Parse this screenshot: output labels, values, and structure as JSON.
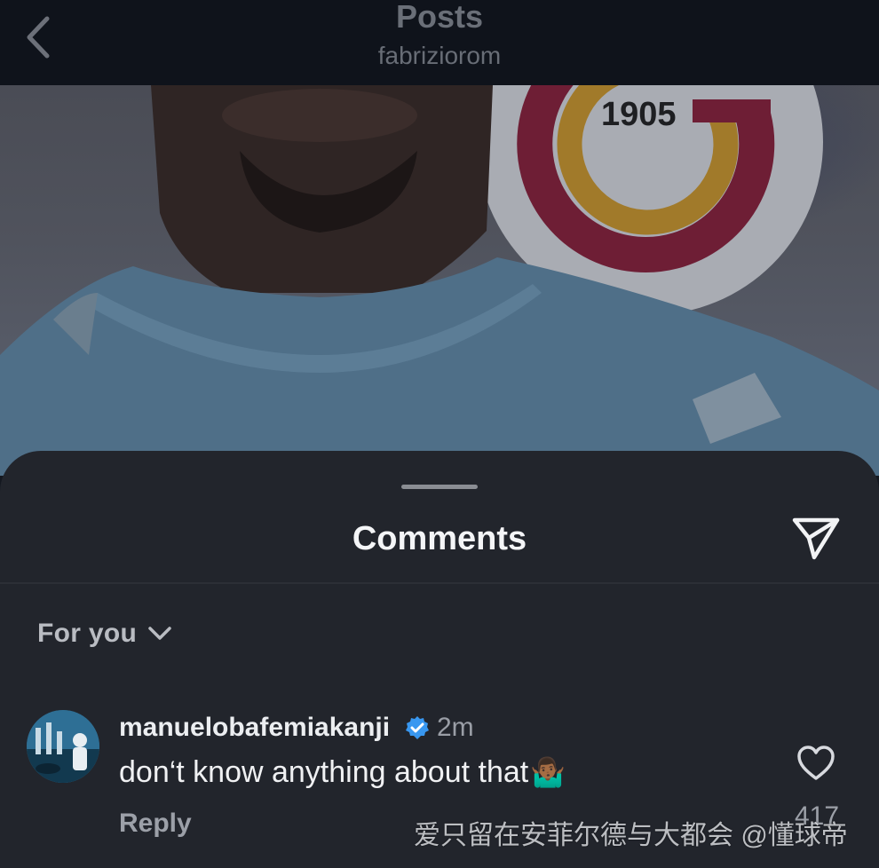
{
  "header": {
    "title": "Posts",
    "username": "fabriziorom"
  },
  "post": {
    "badge_text": "1905"
  },
  "sheet": {
    "title": "Comments"
  },
  "filter": {
    "label": "For you"
  },
  "comment": {
    "username": "manuelobafemiakanji",
    "time": "2m",
    "text": "don‘t know anything about that",
    "emoji": "🤷🏾‍♂️",
    "reply_label": "Reply",
    "like_count": "417"
  },
  "watermark": {
    "text": "爱只留在安菲尔德与大都会 @懂球帝"
  },
  "colors": {
    "sheet_bg": "#22252c",
    "header_bg": "#0f131b",
    "verified_blue": "#3897f0",
    "galatasaray_red": "#8b1d3a",
    "galatasaray_yellow": "#e0a82a"
  },
  "icons": [
    "back-chevron-icon",
    "send-icon",
    "chevron-down-icon",
    "verified-badge-icon",
    "heart-icon"
  ]
}
